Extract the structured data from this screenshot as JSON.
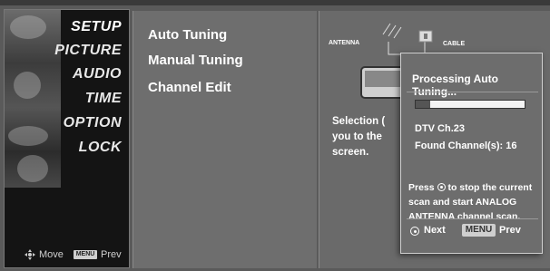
{
  "main_menu": {
    "items": [
      "SETUP",
      "PICTURE",
      "AUDIO",
      "TIME",
      "OPTION",
      "LOCK"
    ],
    "selected": "SETUP"
  },
  "footer": {
    "move_label": "Move",
    "menu_badge": "MENU",
    "prev_label": "Prev"
  },
  "submenu": {
    "items": [
      "Auto Tuning",
      "Manual Tuning",
      "Channel Edit"
    ],
    "selected": "Auto Tuning"
  },
  "diagram": {
    "antenna_label": "ANTENNA",
    "cable_label": "CABLE"
  },
  "description": {
    "lines": [
      "Selection (",
      "you to the",
      "screen."
    ]
  },
  "popup": {
    "title": "Processing Auto Tuning...",
    "progress_fraction": 0.13,
    "channel": "DTV Ch.23",
    "found": "Found Channel(s): 16",
    "instruction_pre": "Press",
    "instruction_post": "to stop the current scan and start ANALOG ANTENNA channel  scan.",
    "next_label": "Next",
    "menu_button": "MENU",
    "prev_label": "Prev"
  },
  "colors": {
    "panel_bg": "#6e6e6e",
    "menu_bg": "#141414",
    "text": "#ffffff"
  }
}
